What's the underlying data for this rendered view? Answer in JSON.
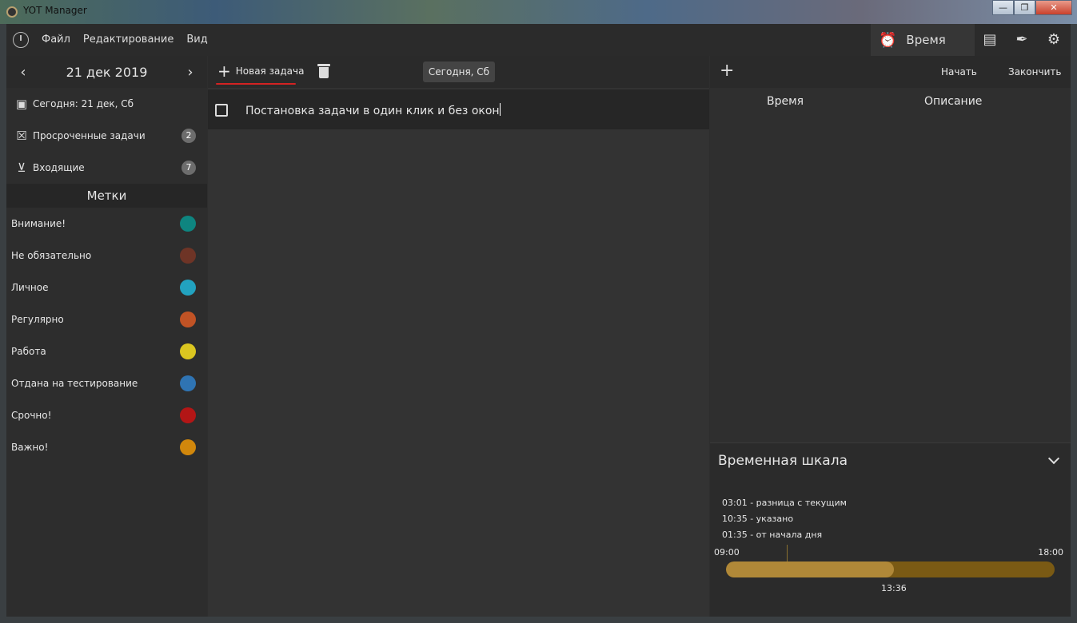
{
  "window": {
    "title": "YOT Manager",
    "controls": [
      "—",
      "❐",
      "✕"
    ]
  },
  "menu": {
    "items": [
      "Файл",
      "Редактирование",
      "Вид"
    ],
    "time_tab": "Время"
  },
  "sidebar": {
    "date": "21 дек 2019",
    "items": [
      {
        "label": "Сегодня: 21 дек, Сб",
        "icon": "calendar-today-icon"
      },
      {
        "label": "Просроченные задачи",
        "icon": "calendar-overdue-icon",
        "badge": "2"
      },
      {
        "label": "Входящие",
        "icon": "inbox-icon",
        "badge": "7"
      }
    ],
    "labels_title": "Метки",
    "tags": [
      {
        "label": "Внимание!",
        "color": "#0e8580"
      },
      {
        "label": "Не обязательно",
        "color": "#6e3426"
      },
      {
        "label": "Личное",
        "color": "#22a2bf"
      },
      {
        "label": "Регулярно",
        "color": "#c15325"
      },
      {
        "label": "Работа",
        "color": "#dbc620"
      },
      {
        "label": "Отдана на тестирование",
        "color": "#2f74b3"
      },
      {
        "label": "Срочно!",
        "color": "#b31616"
      },
      {
        "label": "Важно!",
        "color": "#d1870c"
      }
    ]
  },
  "center": {
    "new_task_label": "Новая задача",
    "today_button": "Сегодня, Сб",
    "tasks": [
      {
        "text": "Постановка задачи в один клик и без окон",
        "done": false
      }
    ]
  },
  "right": {
    "start_label": "Начать",
    "end_label": "Закончить",
    "columns": [
      "Время",
      "Описание"
    ],
    "timeline": {
      "title": "Временная шкала",
      "lines": [
        "03:01 - разница с текущим",
        "10:35 - указано",
        "01:35 - от начала дня"
      ],
      "start": "09:00",
      "end": "18:00",
      "now": "13:36",
      "progress": 0.51
    }
  }
}
